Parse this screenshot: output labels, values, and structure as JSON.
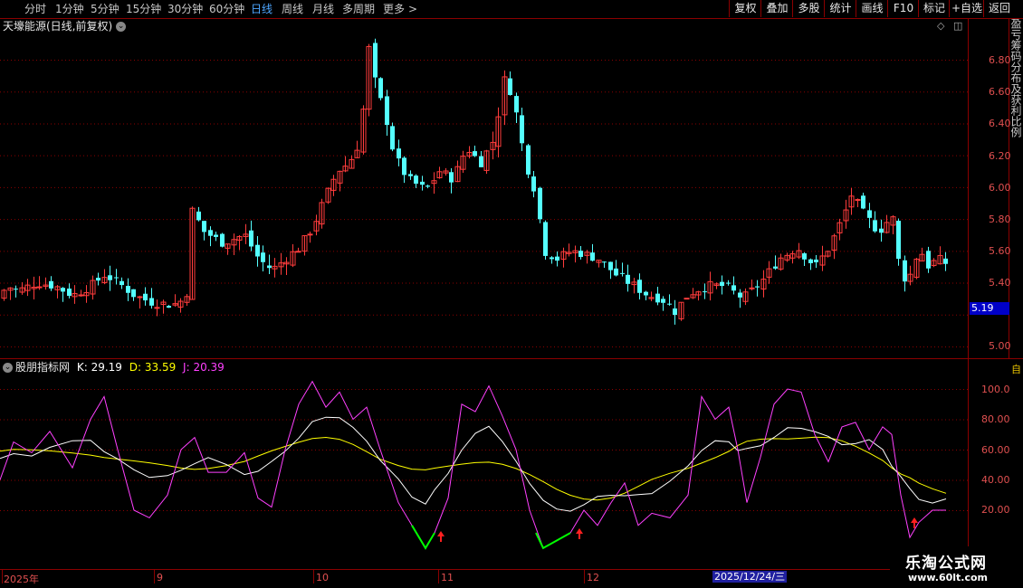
{
  "toolbar": {
    "periods": [
      {
        "label": "分时",
        "active": false
      },
      {
        "label": "1分钟",
        "active": false
      },
      {
        "label": "5分钟",
        "active": false
      },
      {
        "label": "15分钟",
        "active": false
      },
      {
        "label": "30分钟",
        "active": false
      },
      {
        "label": "60分钟",
        "active": false
      },
      {
        "label": "日线",
        "active": true
      },
      {
        "label": "周线",
        "active": false
      },
      {
        "label": "月线",
        "active": false
      },
      {
        "label": "多周期",
        "active": false
      },
      {
        "label": "更多",
        "active": false
      }
    ],
    "more_arrow": ">",
    "buttons": [
      "复权",
      "叠加",
      "多股",
      "统计",
      "画线",
      "F10",
      "标记",
      "+自选",
      "返回"
    ]
  },
  "main_chart": {
    "title": "天壕能源(日线,前复权)",
    "price_axis": [
      "6.80",
      "6.60",
      "6.40",
      "6.20",
      "6.00",
      "5.80",
      "5.60",
      "5.40",
      "5.00"
    ],
    "current_price": "5.19",
    "side_text": "盈亏筹码分布及获利比例"
  },
  "indicator": {
    "name": "股朋指标网",
    "k_label": "K: 29.19",
    "d_label": "D: 33.59",
    "j_label": "J: 20.39",
    "k_color": "#ffffff",
    "d_color": "#ffff00",
    "j_color": "#ff40ff",
    "axis": [
      "100.0",
      "80.00",
      "60.00",
      "40.00",
      "20.00"
    ],
    "side_text": "自"
  },
  "date_axis": {
    "labels": [
      "2025年",
      "9",
      "10",
      "11",
      "12"
    ],
    "cursor_date": "2025/12/24/三"
  },
  "watermark": {
    "line1": "乐淘公式网",
    "line2": "www.60lt.com"
  },
  "colors": {
    "up": "#ff3c3c",
    "down": "#54ffff",
    "grid": "#8b0000",
    "background": "#000000"
  }
}
